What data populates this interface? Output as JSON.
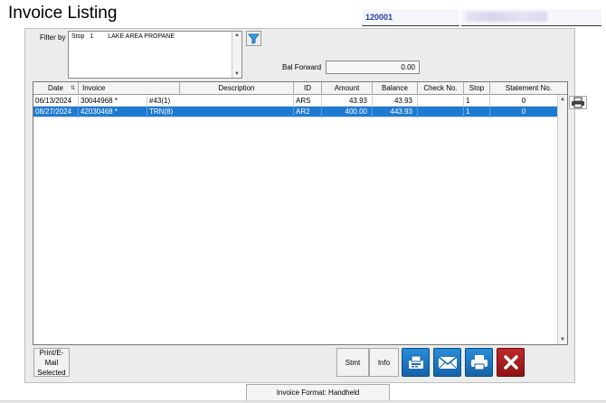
{
  "window": {
    "title": "Invoice Listing"
  },
  "account": {
    "number": "120001"
  },
  "filter": {
    "label": "Filter by",
    "field": "Stop",
    "stop_number": "1",
    "stop_name": "LAKE AREA PROPANE"
  },
  "balance_forward": {
    "label": "Bal Forward",
    "value": "0.00"
  },
  "table": {
    "columns": [
      "Date",
      "Invoice",
      "Description",
      "ID",
      "Amount",
      "Balance",
      "Check No.",
      "Stop",
      "Statement No."
    ],
    "rows": [
      {
        "date": "06/13/2024",
        "invoice": "30044968 *",
        "description": "#43(1)",
        "id": "ARS",
        "amount": "43.93",
        "balance": "43.93",
        "check_no": "",
        "stop": "1",
        "statement_no": "0",
        "selected": false
      },
      {
        "date": "08/27/2024",
        "invoice": "42030468 *",
        "description": "TRN(8)",
        "id": "AR2",
        "amount": "400.00",
        "balance": "443.93",
        "check_no": "",
        "stop": "1",
        "statement_no": "0",
        "selected": true
      }
    ]
  },
  "buttons": {
    "print_email_selected": "Print/E-Mail Selected",
    "stmt": "Stmt",
    "info": "Info"
  },
  "status": {
    "invoice_format": "Invoice Format: Handheld"
  },
  "icons": {
    "filter": "funnel-icon",
    "print_side": "printer-icon",
    "fax": "fax-icon",
    "email": "envelope-icon",
    "print": "printer-icon",
    "close": "close-icon"
  },
  "colors": {
    "selection": "#1d7ad2",
    "account_text": "#1f3f9f",
    "icon_button": "#1a70bd",
    "close_button": "#a81c1c"
  }
}
